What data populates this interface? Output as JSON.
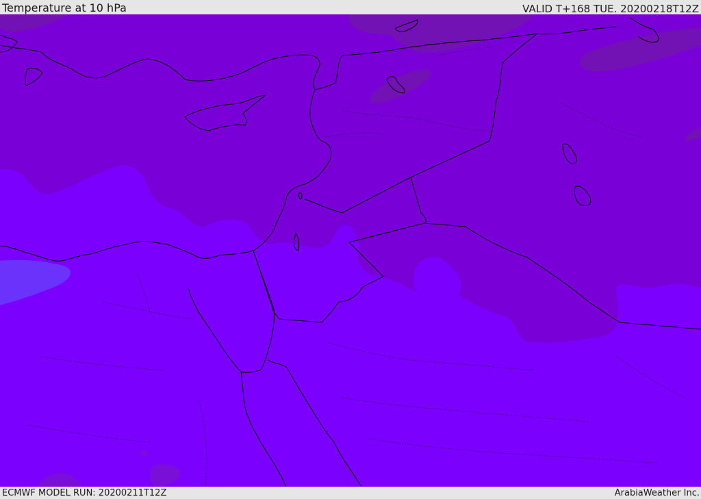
{
  "header": {
    "title": "Temperature at 10 hPa",
    "valid_time": "VALID T+168 TUE. 20200218T12Z"
  },
  "footer": {
    "model_run": "ECMWF MODEL RUN: 20200211T12Z",
    "credit": "ArabiaWeather Inc."
  },
  "map": {
    "field": "temperature",
    "level": "10 hPa",
    "colors": {
      "warm_band": "#7a00d8",
      "warmer_patch": "#7212b4",
      "base": "#7b00fe",
      "cool_patch": "#6a32fa",
      "coastline": "#000000"
    }
  }
}
